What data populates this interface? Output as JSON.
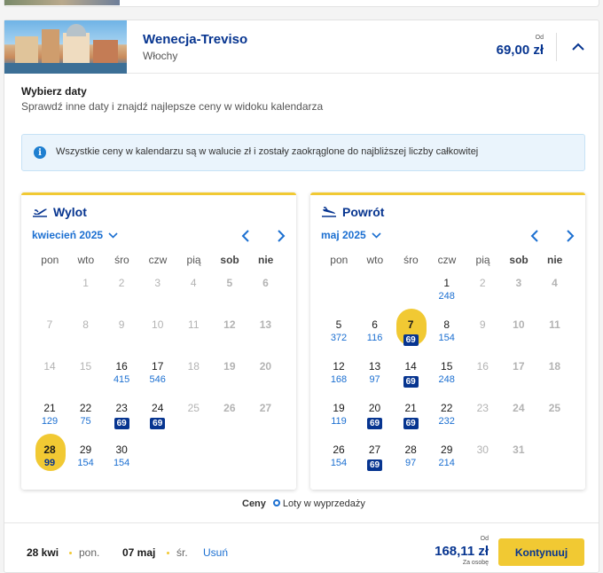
{
  "destination": {
    "name": "Wenecja-Treviso",
    "country": "Włochy",
    "price_from_label": "Od",
    "price": "69,00 zł"
  },
  "section": {
    "title": "Wybierz daty",
    "subtitle": "Sprawdź inne daty i znajdź najlepsze ceny w widoku kalendarza"
  },
  "info": {
    "text": "Wszystkie ceny w kalendarzu są w walucie zł i zostały zaokrąglone do najbliższej liczby całkowitej"
  },
  "weekdays": [
    "pon",
    "wto",
    "śro",
    "czw",
    "pią",
    "sob",
    "nie"
  ],
  "outbound": {
    "title": "Wylot",
    "month": "kwiecień 2025",
    "days": [
      {
        "d": "1",
        "row": 0,
        "col": 1,
        "state": "dis"
      },
      {
        "d": "2",
        "row": 0,
        "col": 2,
        "state": "dis"
      },
      {
        "d": "3",
        "row": 0,
        "col": 3,
        "state": "dis"
      },
      {
        "d": "4",
        "row": 0,
        "col": 4,
        "state": "dis"
      },
      {
        "d": "5",
        "row": 0,
        "col": 5,
        "state": "wk"
      },
      {
        "d": "6",
        "row": 0,
        "col": 6,
        "state": "wk"
      },
      {
        "d": "7",
        "row": 1,
        "col": 0,
        "state": "dis"
      },
      {
        "d": "8",
        "row": 1,
        "col": 1,
        "state": "dis"
      },
      {
        "d": "9",
        "row": 1,
        "col": 2,
        "state": "dis"
      },
      {
        "d": "10",
        "row": 1,
        "col": 3,
        "state": "dis"
      },
      {
        "d": "11",
        "row": 1,
        "col": 4,
        "state": "dis"
      },
      {
        "d": "12",
        "row": 1,
        "col": 5,
        "state": "wk"
      },
      {
        "d": "13",
        "row": 1,
        "col": 6,
        "state": "wk"
      },
      {
        "d": "14",
        "row": 2,
        "col": 0,
        "state": "dis"
      },
      {
        "d": "15",
        "row": 2,
        "col": 1,
        "state": "dis"
      },
      {
        "d": "16",
        "row": 2,
        "col": 2,
        "price": "415"
      },
      {
        "d": "17",
        "row": 2,
        "col": 3,
        "price": "546"
      },
      {
        "d": "18",
        "row": 2,
        "col": 4,
        "state": "dis"
      },
      {
        "d": "19",
        "row": 2,
        "col": 5,
        "state": "wk"
      },
      {
        "d": "20",
        "row": 2,
        "col": 6,
        "state": "wk"
      },
      {
        "d": "21",
        "row": 3,
        "col": 0,
        "price": "129"
      },
      {
        "d": "22",
        "row": 3,
        "col": 1,
        "price": "75"
      },
      {
        "d": "23",
        "row": 3,
        "col": 2,
        "price": "69",
        "sale": true
      },
      {
        "d": "24",
        "row": 3,
        "col": 3,
        "price": "69",
        "sale": true
      },
      {
        "d": "25",
        "row": 3,
        "col": 4,
        "state": "dis"
      },
      {
        "d": "26",
        "row": 3,
        "col": 5,
        "state": "wk"
      },
      {
        "d": "27",
        "row": 3,
        "col": 6,
        "state": "wk"
      },
      {
        "d": "28",
        "row": 4,
        "col": 0,
        "price": "99",
        "selected": true
      },
      {
        "d": "29",
        "row": 4,
        "col": 1,
        "price": "154"
      },
      {
        "d": "30",
        "row": 4,
        "col": 2,
        "price": "154"
      }
    ]
  },
  "return": {
    "title": "Powrót",
    "month": "maj 2025",
    "days": [
      {
        "d": "1",
        "row": 0,
        "col": 3,
        "price": "248"
      },
      {
        "d": "2",
        "row": 0,
        "col": 4,
        "state": "dis"
      },
      {
        "d": "3",
        "row": 0,
        "col": 5,
        "state": "wk"
      },
      {
        "d": "4",
        "row": 0,
        "col": 6,
        "state": "wk"
      },
      {
        "d": "5",
        "row": 1,
        "col": 0,
        "price": "372"
      },
      {
        "d": "6",
        "row": 1,
        "col": 1,
        "price": "116"
      },
      {
        "d": "7",
        "row": 1,
        "col": 2,
        "price": "69",
        "sale": true,
        "selected": true
      },
      {
        "d": "8",
        "row": 1,
        "col": 3,
        "price": "154"
      },
      {
        "d": "9",
        "row": 1,
        "col": 4,
        "state": "dis"
      },
      {
        "d": "10",
        "row": 1,
        "col": 5,
        "state": "wk"
      },
      {
        "d": "11",
        "row": 1,
        "col": 6,
        "state": "wk"
      },
      {
        "d": "12",
        "row": 2,
        "col": 0,
        "price": "168"
      },
      {
        "d": "13",
        "row": 2,
        "col": 1,
        "price": "97"
      },
      {
        "d": "14",
        "row": 2,
        "col": 2,
        "price": "69",
        "sale": true
      },
      {
        "d": "15",
        "row": 2,
        "col": 3,
        "price": "248"
      },
      {
        "d": "16",
        "row": 2,
        "col": 4,
        "state": "dis"
      },
      {
        "d": "17",
        "row": 2,
        "col": 5,
        "state": "wk"
      },
      {
        "d": "18",
        "row": 2,
        "col": 6,
        "state": "wk"
      },
      {
        "d": "19",
        "row": 3,
        "col": 0,
        "price": "119"
      },
      {
        "d": "20",
        "row": 3,
        "col": 1,
        "price": "69",
        "sale": true
      },
      {
        "d": "21",
        "row": 3,
        "col": 2,
        "price": "69",
        "sale": true
      },
      {
        "d": "22",
        "row": 3,
        "col": 3,
        "price": "232"
      },
      {
        "d": "23",
        "row": 3,
        "col": 4,
        "state": "dis"
      },
      {
        "d": "24",
        "row": 3,
        "col": 5,
        "state": "wk"
      },
      {
        "d": "25",
        "row": 3,
        "col": 6,
        "state": "wk"
      },
      {
        "d": "26",
        "row": 4,
        "col": 0,
        "price": "154"
      },
      {
        "d": "27",
        "row": 4,
        "col": 1,
        "price": "69",
        "sale": true
      },
      {
        "d": "28",
        "row": 4,
        "col": 2,
        "price": "97"
      },
      {
        "d": "29",
        "row": 4,
        "col": 3,
        "price": "214"
      },
      {
        "d": "30",
        "row": 4,
        "col": 4,
        "state": "dis"
      },
      {
        "d": "31",
        "row": 4,
        "col": 5,
        "state": "wk"
      }
    ]
  },
  "legend": {
    "label": "Ceny",
    "sale_label": "Loty w wyprzedaży"
  },
  "footer": {
    "out_date": "28 kwi",
    "out_day": "pon.",
    "ret_date": "07 maj",
    "ret_day": "śr.",
    "remove_label": "Usuń",
    "from_label": "Od",
    "total": "168,11 zł",
    "per_person": "Za osobę",
    "continue_label": "Kontynuuj"
  },
  "colors": {
    "brand": "#073590",
    "accent": "#f1c933",
    "link": "#1b6fd1"
  }
}
